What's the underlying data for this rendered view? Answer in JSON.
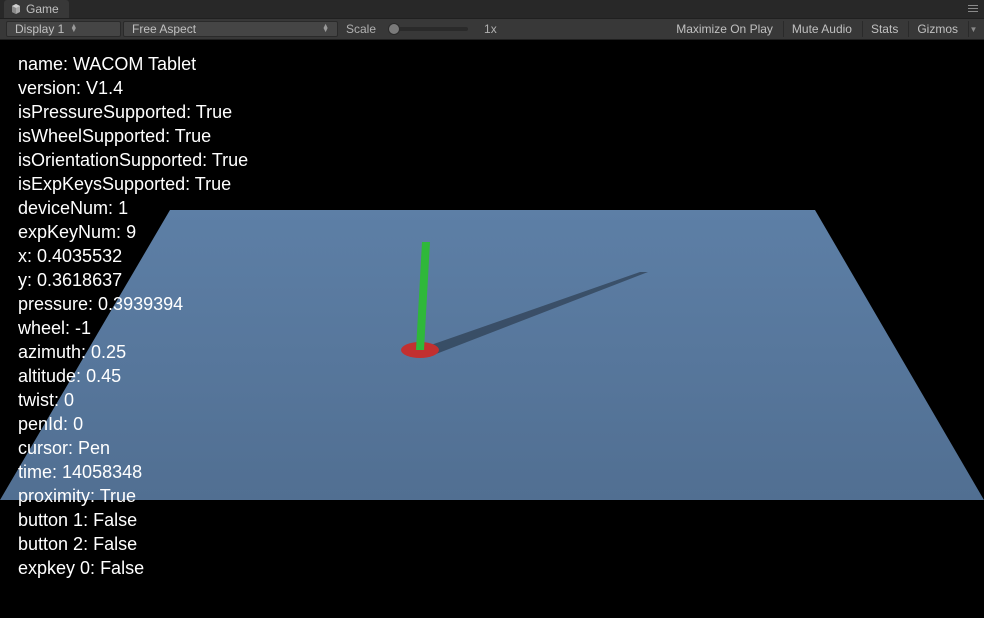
{
  "tab": {
    "label": "Game"
  },
  "toolbar": {
    "display": "Display 1",
    "aspect": "Free Aspect",
    "scale_label": "Scale",
    "scale_value": "1x",
    "maximize": "Maximize On Play",
    "mute": "Mute Audio",
    "stats": "Stats",
    "gizmos": "Gizmos"
  },
  "debug": {
    "name_label": "name",
    "name_value": "WACOM Tablet",
    "version_label": "version",
    "version_value": "V1.4",
    "isPressureSupported_label": "isPressureSupported",
    "isPressureSupported_value": "True",
    "isWheelSupported_label": "isWheelSupported",
    "isWheelSupported_value": "True",
    "isOrientationSupported_label": "isOrientationSupported",
    "isOrientationSupported_value": "True",
    "isExpKeysSupported_label": "isExpKeysSupported",
    "isExpKeysSupported_value": "True",
    "deviceNum_label": "deviceNum",
    "deviceNum_value": "1",
    "expKeyNum_label": "expKeyNum",
    "expKeyNum_value": "9",
    "x_label": "x",
    "x_value": "0.4035532",
    "y_label": "y",
    "y_value": "0.3618637",
    "pressure_label": "pressure",
    "pressure_value": "0.3939394",
    "wheel_label": "wheel",
    "wheel_value": "-1",
    "azimuth_label": "azimuth",
    "azimuth_value": "0.25",
    "altitude_label": "altitude",
    "altitude_value": "0.45",
    "twist_label": "twist",
    "twist_value": "0",
    "penId_label": "penId",
    "penId_value": "0",
    "cursor_label": "cursor",
    "cursor_value": "Pen",
    "time_label": "time",
    "time_value": "14058348",
    "proximity_label": "proximity",
    "proximity_value": "True",
    "button1_label": "button 1",
    "button1_value": "False",
    "button2_label": "button 2",
    "button2_value": "False",
    "expkey0_label": "expkey 0",
    "expkey0_value": "False"
  }
}
